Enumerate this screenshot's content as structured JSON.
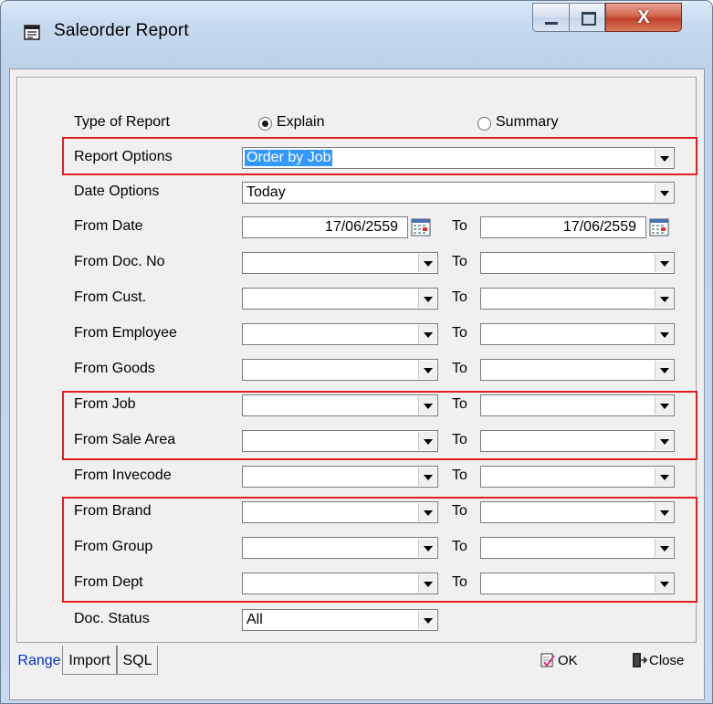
{
  "window": {
    "title": "Saleorder Report",
    "close_glyph": "X"
  },
  "form": {
    "type_label": "Type of Report",
    "type_options": [
      "Explain",
      "Summary"
    ],
    "type_selected": "Explain",
    "report_options_label": "Report Options",
    "report_options_value": "Order by Job",
    "date_options_label": "Date Options",
    "date_options_value": "Today",
    "from_date_label": "From Date",
    "from_date_value": "17/06/2559",
    "to_label": "To",
    "to_date_value": "17/06/2559",
    "range_rows": [
      {
        "label": "From Doc. No",
        "from": "",
        "to": ""
      },
      {
        "label": "From Cust.",
        "from": "",
        "to": ""
      },
      {
        "label": "From Employee",
        "from": "",
        "to": ""
      },
      {
        "label": "From Goods",
        "from": "",
        "to": ""
      },
      {
        "label": "From Job",
        "from": "",
        "to": ""
      },
      {
        "label": "From Sale Area",
        "from": "",
        "to": ""
      },
      {
        "label": "From Invecode",
        "from": "",
        "to": ""
      },
      {
        "label": "From Brand",
        "from": "",
        "to": ""
      },
      {
        "label": "From Group",
        "from": "",
        "to": ""
      },
      {
        "label": "From Dept",
        "from": "",
        "to": ""
      }
    ],
    "doc_status_label": "Doc. Status",
    "doc_status_value": "All"
  },
  "tabs": [
    "Range",
    "Import",
    "SQL"
  ],
  "active_tab": "Range",
  "buttons": {
    "ok": "OK",
    "close": "Close"
  },
  "colors": {
    "highlight": "#e02020",
    "selection": "#3399ff",
    "active_tab": "#0033cc"
  }
}
